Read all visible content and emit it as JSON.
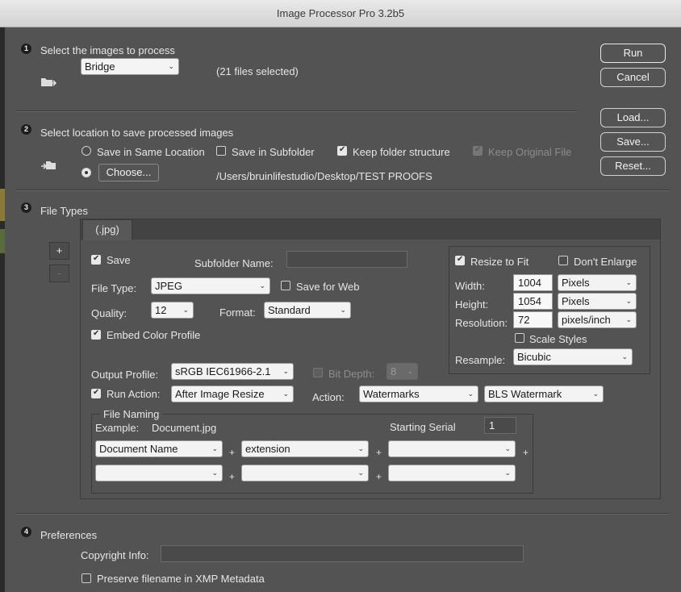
{
  "window": {
    "title": "Image Processor Pro 3.2b5"
  },
  "buttons": {
    "run": "Run",
    "cancel": "Cancel",
    "load": "Load...",
    "save": "Save...",
    "reset": "Reset..."
  },
  "section1": {
    "number": "1",
    "title": "Select the images to process",
    "source_value": "Bridge",
    "files_selected": "(21 files selected)"
  },
  "section2": {
    "number": "2",
    "title": "Select location to save processed images",
    "same_location": "Save in Same Location",
    "subfolder": "Save in Subfolder",
    "keep_structure": "Keep folder structure",
    "keep_original": "Keep Original File",
    "choose": "Choose...",
    "path": "/Users/bruinlifestudio/Desktop/TEST PROOFS"
  },
  "section3": {
    "number": "3",
    "title": "File Types",
    "add": "+",
    "remove": "-",
    "tab_label": "(.jpg)",
    "save_label": "Save",
    "subfolder_name_label": "Subfolder Name:",
    "subfolder_name_value": "",
    "file_type_label": "File Type:",
    "file_type_value": "JPEG",
    "save_for_web": "Save for Web",
    "quality_label": "Quality:",
    "quality_value": "12",
    "format_label": "Format:",
    "format_value": "Standard",
    "embed_profile": "Embed Color Profile",
    "output_profile_label": "Output Profile:",
    "output_profile_value": "sRGB IEC61966-2.1",
    "bit_depth_label": "Bit Depth:",
    "bit_depth_value": "8",
    "run_action_label": "Run Action:",
    "run_action_value": "After Image Resize",
    "action_label": "Action:",
    "action_set": "Watermarks",
    "action_name": "BLS Watermark",
    "resize": {
      "resize_to_fit": "Resize to Fit",
      "dont_enlarge": "Don't Enlarge",
      "width_label": "Width:",
      "width_value": "1004",
      "width_unit": "Pixels",
      "height_label": "Height:",
      "height_value": "1054",
      "height_unit": "Pixels",
      "resolution_label": "Resolution:",
      "resolution_value": "72",
      "resolution_unit": "pixels/inch",
      "scale_styles": "Scale Styles",
      "resample_label": "Resample:",
      "resample_value": "Bicubic"
    },
    "naming": {
      "legend": "File Naming",
      "example_label": "Example:",
      "example_value": "Document.jpg",
      "starting_serial_label": "Starting Serial",
      "starting_serial_value": "1",
      "row1": [
        "Document Name",
        "extension",
        ""
      ],
      "row2": [
        "",
        "",
        ""
      ],
      "plus": "+"
    }
  },
  "section4": {
    "number": "4",
    "title": "Preferences",
    "copyright_label": "Copyright Info:",
    "copyright_value": "",
    "preserve_filename": "Preserve filename in XMP Metadata"
  }
}
